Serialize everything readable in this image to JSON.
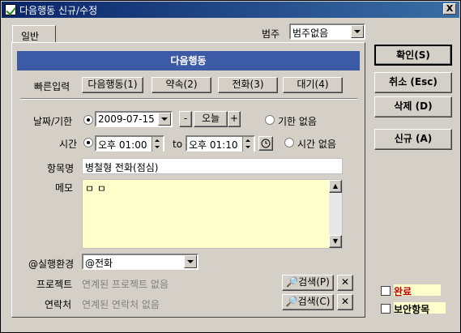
{
  "window": {
    "title": "다음행동 신규/수정",
    "close_label": "X"
  },
  "category": {
    "label": "범주",
    "value": "범주없음"
  },
  "tab": {
    "label": "일반"
  },
  "header": {
    "title": "다음행동"
  },
  "quick_input": {
    "label": "빠른입력",
    "buttons": [
      "다음행동(1)",
      "약속(2)",
      "전화(3)",
      "대기(4)"
    ]
  },
  "date": {
    "label": "날짜/기한",
    "value": "2009-07-15",
    "minus": "-",
    "today": "오늘",
    "plus": "+",
    "no_deadline": "기한 없음"
  },
  "time": {
    "label": "시간",
    "start": "오후 01:00",
    "to": "to",
    "end": "오후 01:10",
    "no_time": "시간 없음"
  },
  "item_name": {
    "label": "항목명",
    "value": "병철형 전화(점심)"
  },
  "memo": {
    "label": "메모",
    "value": "ㅁ ㅁ"
  },
  "context": {
    "label": "@실행환경",
    "value": "@전화"
  },
  "project": {
    "label": "프로젝트",
    "value": "연계된 프로젝트 없음",
    "search": "검색(P)"
  },
  "contact": {
    "label": "연락처",
    "value": "연계된 연락처 없음",
    "search": "검색(C)"
  },
  "side_buttons": {
    "ok": "확인(S)",
    "cancel": "취소 (Esc)",
    "delete": "삭제 (D)",
    "new": "신규 (A)"
  },
  "checkboxes": {
    "done": "완료",
    "secure": "보안항목"
  },
  "colors": {
    "header": "#3c5aa6",
    "memo_bg": "#ffffcc",
    "done_label": "#c00000"
  }
}
